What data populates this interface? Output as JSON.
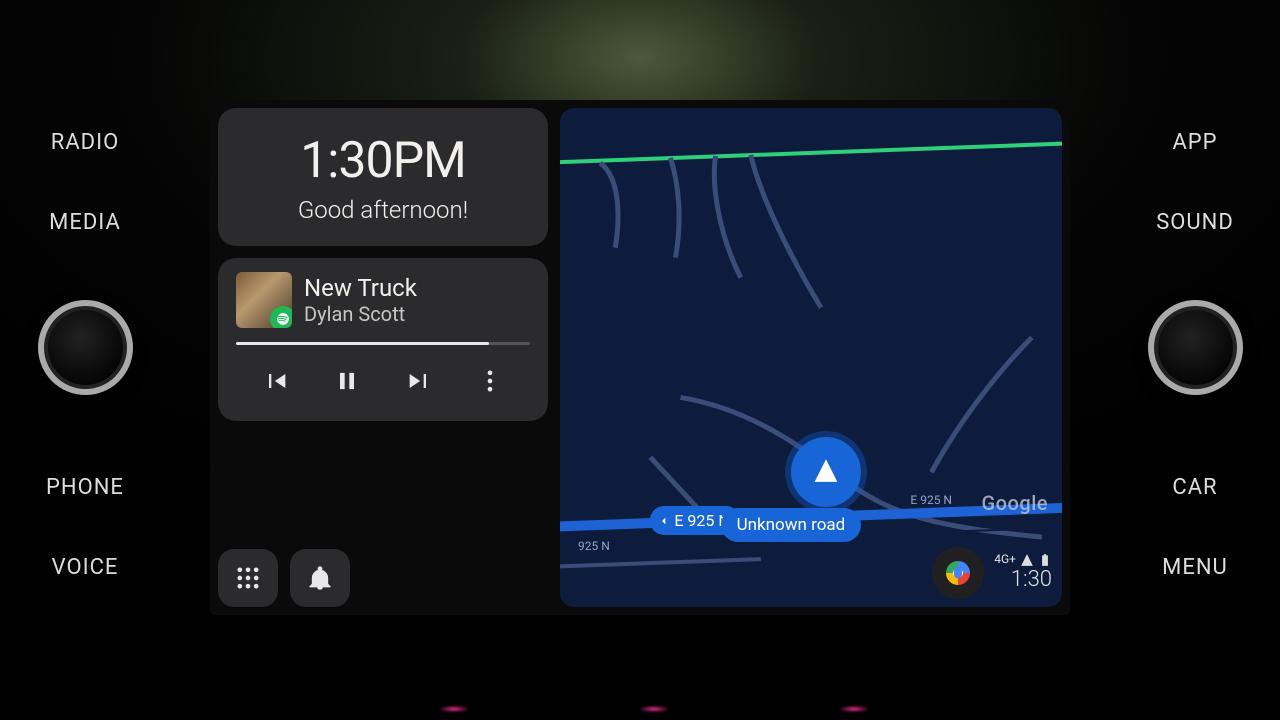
{
  "bezel": {
    "left": [
      "RADIO",
      "MEDIA",
      "PHONE",
      "VOICE"
    ],
    "right": [
      "APP",
      "SOUND",
      "CAR",
      "MENU"
    ]
  },
  "greeting": {
    "time": "1:30PM",
    "text": "Good afternoon!"
  },
  "media": {
    "title": "New Truck",
    "artist": "Dylan Scott",
    "source": "spotify",
    "progress_pct": 86
  },
  "map": {
    "provider": "Google",
    "current_road": "Unknown road",
    "cross_street": "E 925 N",
    "road_label_1": "E 925 N",
    "road_label_2": "925 N"
  },
  "status": {
    "network": "4G+",
    "time": "1:30"
  }
}
